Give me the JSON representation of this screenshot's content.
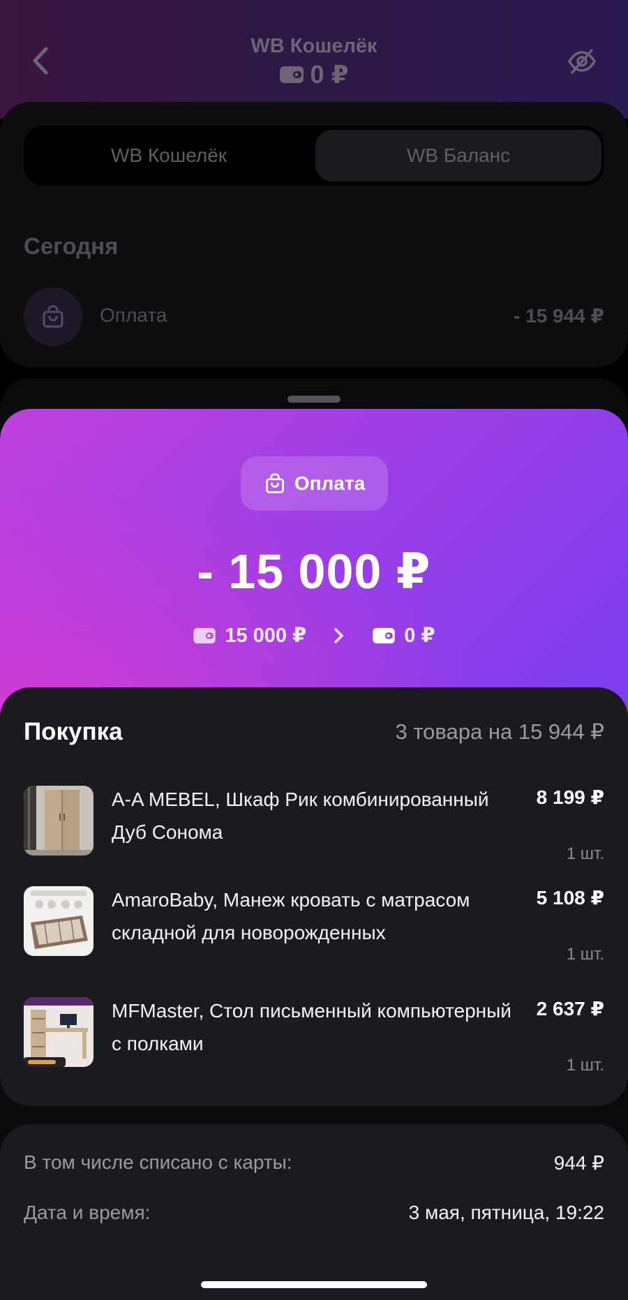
{
  "header": {
    "title": "WB Кошелёк",
    "balance": "0 ₽"
  },
  "tabs": [
    {
      "label": "WB Кошелёк"
    },
    {
      "label": "WB Баланс"
    }
  ],
  "history": {
    "section": "Сегодня",
    "transaction": {
      "label": "Оплата",
      "amount": "- 15 944 ₽"
    }
  },
  "sheet": {
    "type_label": "Оплата",
    "amount": "- 15 000 ₽",
    "from_amount": "15 000 ₽",
    "to_amount": "0 ₽"
  },
  "purchase": {
    "title": "Покупка",
    "summary": "3 товара на 15 944 ₽",
    "items": [
      {
        "name": "A-A MEBEL, Шкаф Рик комбинированный Дуб Сонома",
        "price": "8 199 ₽",
        "qty": "1 шт."
      },
      {
        "name": "AmaroBaby, Манеж кровать с матрасом складной для новорожденных",
        "price": "5 108 ₽",
        "qty": "1 шт."
      },
      {
        "name": "MFMaster, Стол письменный компьютерный с полками",
        "price": "2 637 ₽",
        "qty": "1 шт."
      }
    ]
  },
  "details": {
    "card_label": "В том числе списано с карты:",
    "card_value": "944 ₽",
    "datetime_label": "Дата и время:",
    "datetime_value": "3 мая, пятница, 19:22"
  },
  "icons": {
    "back": "chevron-left-icon",
    "wallet": "wallet-icon",
    "hide": "eye-off-icon",
    "bag": "shopping-bag-icon",
    "arrow": "chevron-right-icon"
  },
  "colors": {
    "accent_start": "#c040dd",
    "accent_end": "#7a3cf0",
    "background": "#0b0b0d",
    "card": "#1b1b1f"
  }
}
